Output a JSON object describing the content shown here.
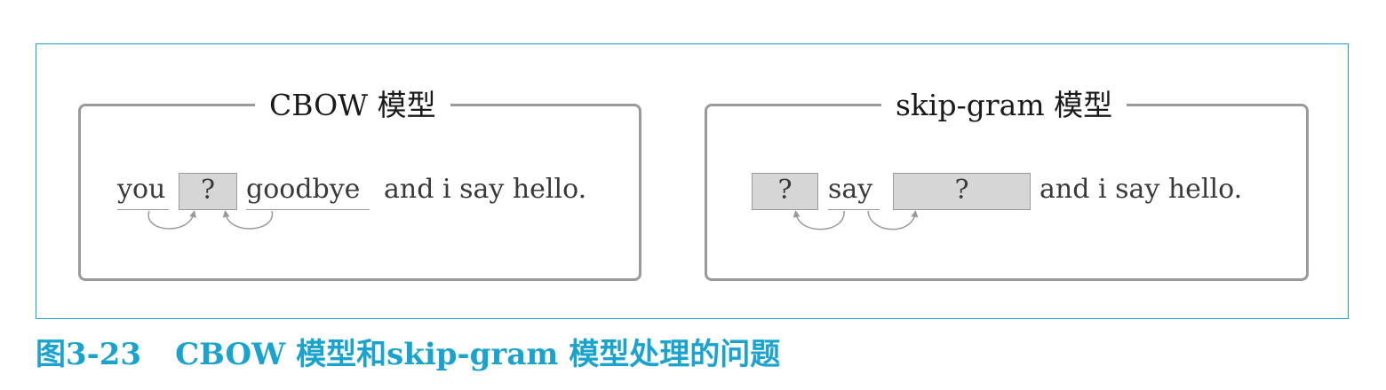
{
  "cbow": {
    "title": "CBOW 模型",
    "context_left": "you",
    "target": "?",
    "context_right": "goodbye",
    "rest": "and i say hello."
  },
  "skipgram": {
    "title": "skip-gram 模型",
    "context_left": "?",
    "target": "say",
    "context_right": "?",
    "rest": "and i say hello."
  },
  "caption": {
    "number": "图3-23",
    "text": "CBOW 模型和skip-gram 模型处理的问题"
  }
}
